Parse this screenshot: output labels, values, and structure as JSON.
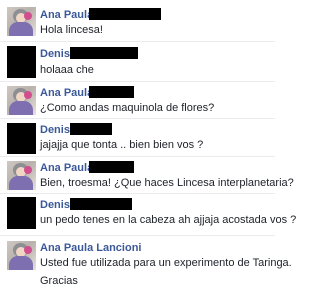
{
  "messages": [
    {
      "sender": "Ana Paula",
      "lines": [
        "Hola lincesa!"
      ]
    },
    {
      "sender": "Denis",
      "lines": [
        "holaaa che"
      ]
    },
    {
      "sender": "Ana Paula",
      "lines": [
        "¿Como andas maquinola de flores?"
      ]
    },
    {
      "sender": "Denis",
      "lines": [
        "jajajja que tonta .. bien bien vos ?"
      ]
    },
    {
      "sender": "Ana Paula",
      "lines": [
        "Bien, troesma! ¿Que haces Lincesa interplanetaria?"
      ]
    },
    {
      "sender": "Denis",
      "lines": [
        "un pedo tenes en la cabeza ah ajjaja acostada vos ?"
      ]
    },
    {
      "sender": "Ana Paula Lancioni",
      "lines": [
        "Usted fue utilizada para un experimento de Taringa.",
        "Gracias"
      ]
    }
  ]
}
